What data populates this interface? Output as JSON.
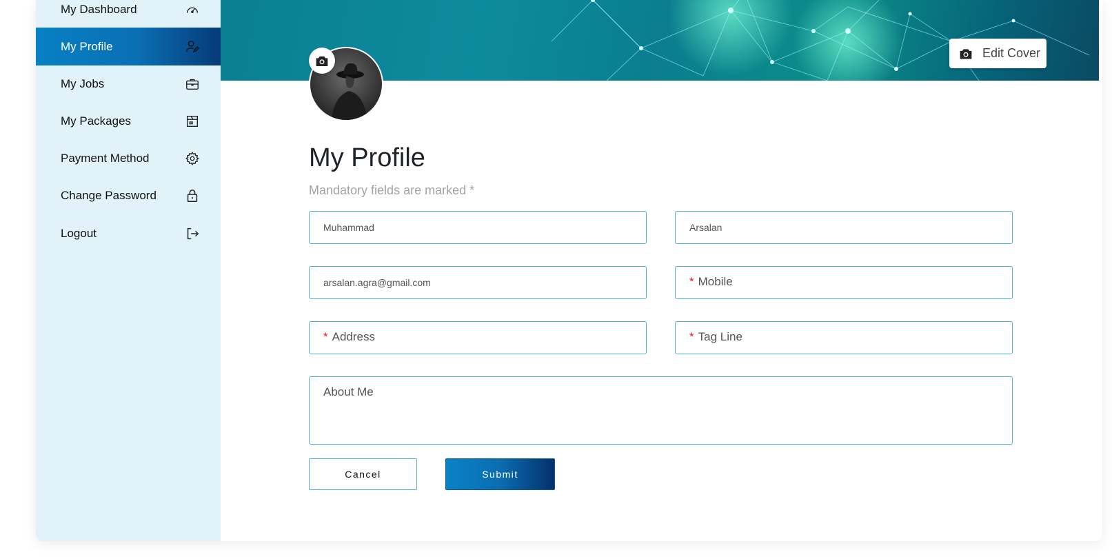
{
  "sidebar": {
    "items": [
      {
        "label": "My Dashboard",
        "icon": "speedometer-icon",
        "active": false
      },
      {
        "label": "My Profile",
        "icon": "user-edit-icon",
        "active": true
      },
      {
        "label": "My Jobs",
        "icon": "briefcase-icon",
        "active": false
      },
      {
        "label": "My Packages",
        "icon": "package-icon",
        "active": false
      },
      {
        "label": "Payment Method",
        "icon": "gear-icon",
        "active": false
      },
      {
        "label": "Change Password",
        "icon": "lock-icon",
        "active": false
      },
      {
        "label": "Logout",
        "icon": "logout-icon",
        "active": false
      }
    ]
  },
  "cover": {
    "edit_label": "Edit Cover"
  },
  "profile": {
    "title": "My Profile",
    "subtitle": "Mandatory fields are marked *",
    "fields": {
      "first_name": {
        "value": "Muhammad"
      },
      "last_name": {
        "value": "Arsalan"
      },
      "email": {
        "value": "arsalan.agra@gmail.com"
      },
      "mobile": {
        "placeholder": "Mobile",
        "required": true
      },
      "address": {
        "placeholder": "Address",
        "required": true
      },
      "tag_line": {
        "placeholder": "Tag Line",
        "required": true
      },
      "about_me": {
        "placeholder": "About Me",
        "required": false
      }
    },
    "required_mark": "*",
    "cancel_label": "Cancel",
    "submit_label": "Submit"
  },
  "colors": {
    "sidebar_bg": "#e1f2f9",
    "active_start": "#0880c4",
    "active_end": "#063a78",
    "field_border": "#4fb4d3",
    "required_star": "#e0201e"
  }
}
